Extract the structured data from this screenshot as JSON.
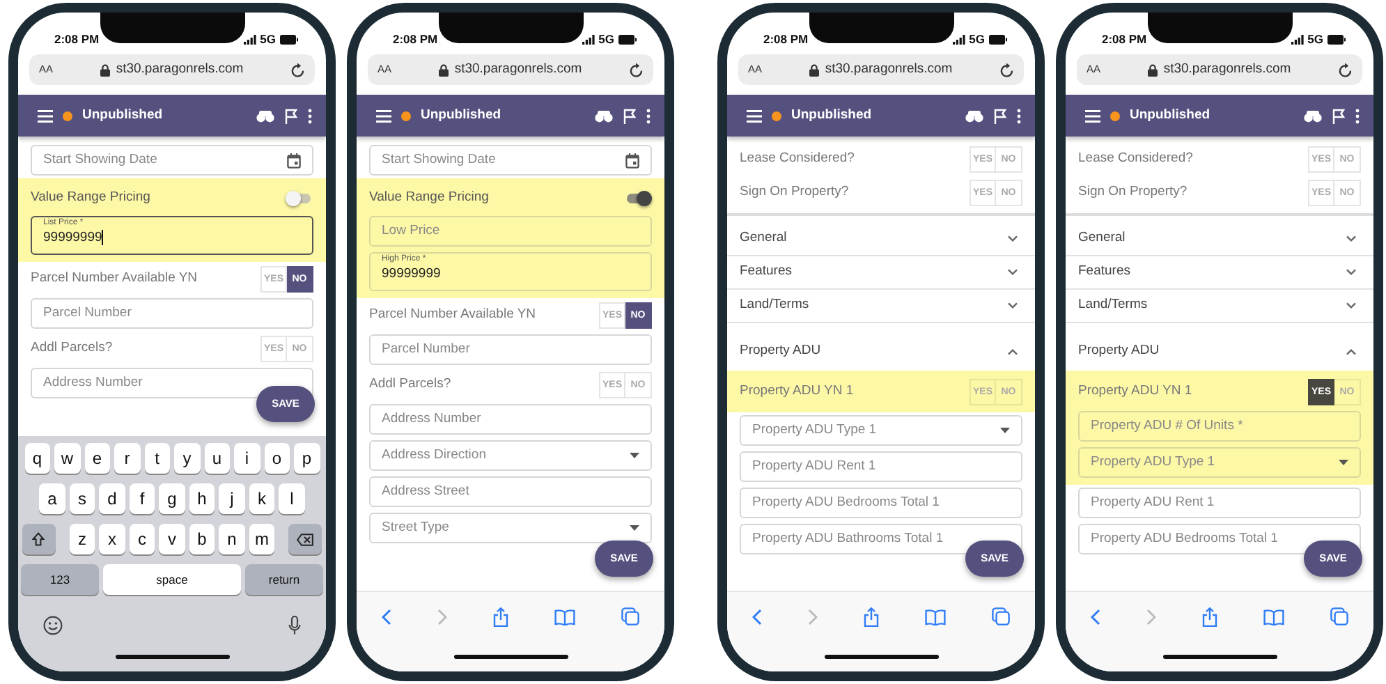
{
  "phones": [
    {
      "status_bar": {
        "time": "2:08 PM",
        "network": "5G"
      },
      "address_bar": {
        "text_size": "AA",
        "url": "st30.paragonrels.com"
      },
      "app_bar": {
        "status": "Unpublished"
      },
      "content": [
        {
          "kind": "date_field",
          "placeholder": "Start Showing Date"
        },
        {
          "kind": "group",
          "highlighted": true,
          "items": [
            {
              "kind": "switch",
              "label": "Value Range Pricing",
              "on": false
            },
            {
              "kind": "field",
              "label": "List Price *",
              "value": "99999999",
              "focused": true
            }
          ]
        },
        {
          "kind": "yesno",
          "label": "Parcel Number Available YN",
          "options": [
            {
              "label": "YES",
              "selected": false
            },
            {
              "label": "NO",
              "selected": true
            }
          ]
        },
        {
          "kind": "field",
          "placeholder": "Parcel Number"
        },
        {
          "kind": "yesno",
          "label": "Addl Parcels?",
          "options": [
            {
              "label": "YES",
              "selected": false
            },
            {
              "label": "NO",
              "selected": false
            }
          ]
        },
        {
          "kind": "field",
          "placeholder": "Address Number"
        }
      ],
      "save_button": "SAVE",
      "bottom": {
        "kind": "keyboard",
        "rows": [
          [
            "q",
            "w",
            "e",
            "r",
            "t",
            "y",
            "u",
            "i",
            "o",
            "p"
          ],
          [
            "a",
            "s",
            "d",
            "f",
            "g",
            "h",
            "j",
            "k",
            "l"
          ],
          [
            "z",
            "x",
            "c",
            "v",
            "b",
            "n",
            "m"
          ]
        ],
        "keys": [
          "123",
          "space",
          "return"
        ]
      }
    },
    {
      "status_bar": {
        "time": "2:08 PM",
        "network": "5G"
      },
      "address_bar": {
        "text_size": "AA",
        "url": "st30.paragonrels.com"
      },
      "app_bar": {
        "status": "Unpublished"
      },
      "content": [
        {
          "kind": "date_field",
          "placeholder": "Start Showing Date"
        },
        {
          "kind": "group",
          "highlighted": true,
          "items": [
            {
              "kind": "switch",
              "label": "Value Range Pricing",
              "on": true
            },
            {
              "kind": "field",
              "placeholder": "Low Price"
            },
            {
              "kind": "field",
              "label": "High Price *",
              "value": "99999999"
            }
          ]
        },
        {
          "kind": "yesno",
          "label": "Parcel Number Available YN",
          "options": [
            {
              "label": "YES",
              "selected": false
            },
            {
              "label": "NO",
              "selected": true
            }
          ]
        },
        {
          "kind": "field",
          "placeholder": "Parcel Number"
        },
        {
          "kind": "yesno",
          "label": "Addl Parcels?",
          "options": [
            {
              "label": "YES",
              "selected": false
            },
            {
              "label": "NO",
              "selected": false
            }
          ]
        },
        {
          "kind": "field",
          "placeholder": "Address Number"
        },
        {
          "kind": "dropdown_field",
          "placeholder": "Address Direction"
        },
        {
          "kind": "field",
          "placeholder": "Address Street"
        },
        {
          "kind": "dropdown_field",
          "placeholder": "Street Type"
        }
      ],
      "save_button": "SAVE",
      "bottom": {
        "kind": "toolbar"
      }
    },
    {
      "status_bar": {
        "time": "2:08 PM",
        "network": "5G"
      },
      "address_bar": {
        "text_size": "AA",
        "url": "st30.paragonrels.com"
      },
      "app_bar": {
        "status": "Unpublished"
      },
      "content": [
        {
          "kind": "yesno",
          "label": "Lease Considered?",
          "options": [
            {
              "label": "YES",
              "selected": false
            },
            {
              "label": "NO",
              "selected": false
            }
          ]
        },
        {
          "kind": "yesno",
          "label": "Sign On Property?",
          "options": [
            {
              "label": "YES",
              "selected": false
            },
            {
              "label": "NO",
              "selected": false
            }
          ]
        },
        {
          "kind": "divider"
        },
        {
          "kind": "section",
          "label": "General",
          "expanded": false
        },
        {
          "kind": "section",
          "label": "Features",
          "expanded": false
        },
        {
          "kind": "section",
          "label": "Land/Terms",
          "expanded": false
        },
        {
          "kind": "section",
          "label": "Property ADU",
          "expanded": true
        },
        {
          "kind": "group",
          "highlighted": true,
          "items": [
            {
              "kind": "yesno",
              "label": "Property ADU YN 1",
              "options": [
                {
                  "label": "YES",
                  "selected": false
                },
                {
                  "label": "NO",
                  "selected": false
                }
              ]
            }
          ]
        },
        {
          "kind": "dropdown_field",
          "placeholder": "Property ADU Type 1"
        },
        {
          "kind": "field",
          "placeholder": "Property ADU Rent 1"
        },
        {
          "kind": "field",
          "placeholder": "Property ADU Bedrooms Total 1"
        },
        {
          "kind": "field",
          "placeholder": "Property ADU Bathrooms Total 1"
        }
      ],
      "save_button": "SAVE",
      "bottom": {
        "kind": "toolbar"
      }
    },
    {
      "status_bar": {
        "time": "2:08 PM",
        "network": "5G"
      },
      "address_bar": {
        "text_size": "AA",
        "url": "st30.paragonrels.com"
      },
      "app_bar": {
        "status": "Unpublished"
      },
      "content": [
        {
          "kind": "yesno",
          "label": "Lease Considered?",
          "options": [
            {
              "label": "YES",
              "selected": false
            },
            {
              "label": "NO",
              "selected": false
            }
          ]
        },
        {
          "kind": "yesno",
          "label": "Sign On Property?",
          "options": [
            {
              "label": "YES",
              "selected": false
            },
            {
              "label": "NO",
              "selected": false
            }
          ]
        },
        {
          "kind": "divider"
        },
        {
          "kind": "section",
          "label": "General",
          "expanded": false
        },
        {
          "kind": "section",
          "label": "Features",
          "expanded": false
        },
        {
          "kind": "section",
          "label": "Land/Terms",
          "expanded": false
        },
        {
          "kind": "section",
          "label": "Property ADU",
          "expanded": true
        },
        {
          "kind": "group",
          "highlighted": true,
          "items": [
            {
              "kind": "yesno",
              "label": "Property ADU YN 1",
              "options": [
                {
                  "label": "YES",
                  "selected": true
                },
                {
                  "label": "NO",
                  "selected": false
                }
              ]
            },
            {
              "kind": "field",
              "placeholder": "Property ADU # Of Units *"
            },
            {
              "kind": "dropdown_field",
              "placeholder": "Property ADU Type 1"
            }
          ]
        },
        {
          "kind": "field",
          "placeholder": "Property ADU Rent 1"
        },
        {
          "kind": "field",
          "placeholder": "Property ADU Bedrooms Total 1"
        }
      ],
      "save_button": "SAVE",
      "bottom": {
        "kind": "toolbar"
      }
    }
  ]
}
